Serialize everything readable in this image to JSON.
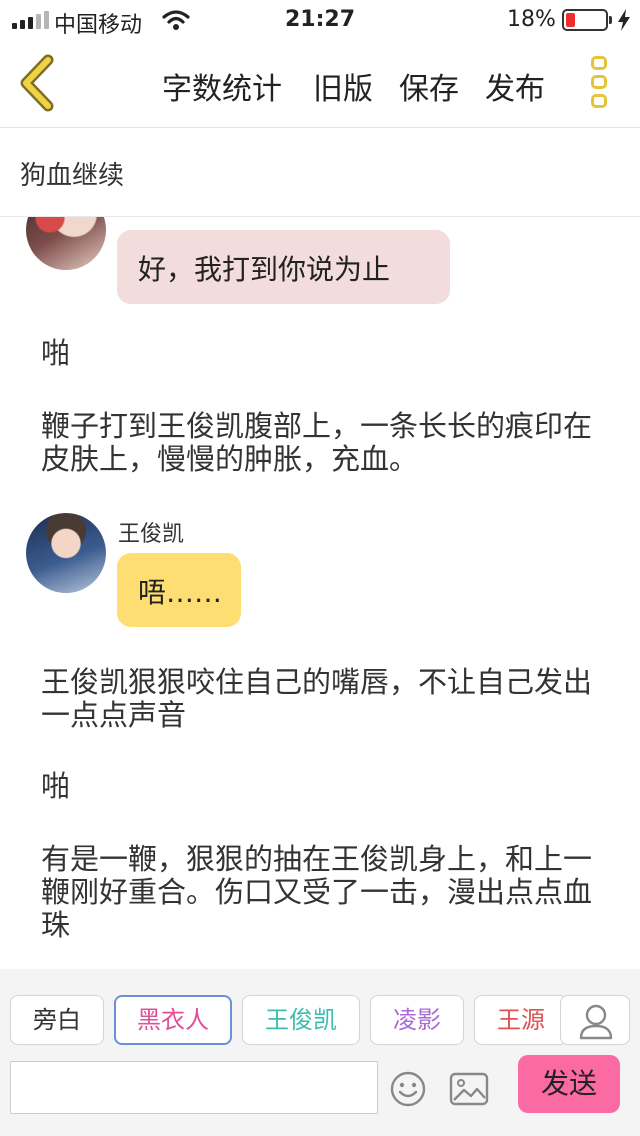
{
  "status_bar": {
    "carrier": "中国移动",
    "time": "21:27",
    "battery_percent": "18%",
    "battery_level": 0.18,
    "icons": [
      "signal-icon",
      "wifi-icon",
      "battery-icon",
      "charging-icon"
    ]
  },
  "navbar": {
    "back_icon": "chevron-left-icon",
    "items": [
      "字数统计",
      "旧版",
      "保存",
      "发布"
    ],
    "menu_icon": "more-vertical-icon",
    "accent_color": "#e6c43a"
  },
  "chapter": {
    "title": "狗血继续"
  },
  "feed": {
    "bubble1": {
      "text": "好，我打到你说为止",
      "color": "#f2dcdc"
    },
    "narration1": "啪",
    "narration2": "鞭子打到王俊凯腹部上，一条长长的痕印在皮肤上，慢慢的肿胀，充血。",
    "speaker2": "王俊凯",
    "bubble2": {
      "text": "唔……",
      "color": "#fedd72"
    },
    "narration3": "王俊凯狠狠咬住自己的嘴唇，不让自己发出一点点声音",
    "narration4": "啪",
    "narration5": "有是一鞭，狠狠的抽在王俊凯身上，和上一鞭刚好重合。伤口又受了一击，漫出点点血珠"
  },
  "toolbar": {
    "roles": [
      {
        "label": "旁白",
        "color": "#333333",
        "selected": false
      },
      {
        "label": "黑衣人",
        "color": "#e0509a",
        "selected": true
      },
      {
        "label": "王俊凯",
        "color": "#3bbdb0",
        "selected": false
      },
      {
        "label": "凌影",
        "color": "#a86ad8",
        "selected": false
      },
      {
        "label": "王源",
        "color": "#e05050",
        "selected": false
      }
    ],
    "role_manage_icon": "person-icon",
    "input_value": "",
    "emoji_icon": "emoji-icon",
    "image_icon": "image-icon",
    "send_label": "发送",
    "send_color": "#fb6aa3"
  }
}
